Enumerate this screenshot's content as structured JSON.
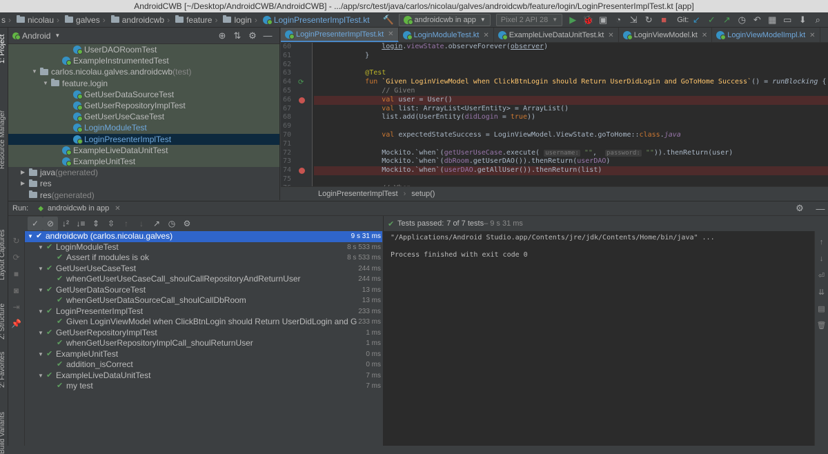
{
  "window_title": "AndroidCWB [~/Desktop/AndroidCWB/AndroidCWB] - .../app/src/test/java/carlos/nicolau/galves/androidcwb/feature/login/LoginPresenterImplTest.kt [app]",
  "nav": {
    "crumbs": [
      "s",
      "nicolau",
      "galves",
      "androidcwb",
      "feature",
      "login",
      "LoginPresenterImplTest.kt"
    ],
    "run_config": "androidcwb in app",
    "device": "Pixel 2 API 28",
    "git_label": "Git:"
  },
  "left_strip": {
    "project": "1: Project",
    "resource_manager": "Resource Manager",
    "layout_captures": "Layout Captures",
    "structure": "Z: Structure",
    "favorites": "2: Favorites",
    "build_variants": "Build Variants"
  },
  "project": {
    "view": "Android",
    "tree": [
      {
        "label": "UserDAORoomTest",
        "indent": 5,
        "icon": "class",
        "style": "green"
      },
      {
        "label": "ExampleInstrumentedTest",
        "indent": 4,
        "icon": "class",
        "style": "green"
      },
      {
        "label": "carlos.nicolau.galves.androidcwb",
        "suffix": " (test)",
        "indent": 2,
        "icon": "folder",
        "expanded": true,
        "style": "green"
      },
      {
        "label": "feature.login",
        "indent": 3,
        "icon": "folder",
        "expanded": true,
        "style": "green"
      },
      {
        "label": "GetUserDataSourceTest",
        "indent": 5,
        "icon": "class",
        "style": "green"
      },
      {
        "label": "GetUserRepositoryImplTest",
        "indent": 5,
        "icon": "class",
        "style": "green"
      },
      {
        "label": "GetUserUseCaseTest",
        "indent": 5,
        "icon": "class",
        "style": "green"
      },
      {
        "label": "LoginModuleTest",
        "indent": 5,
        "icon": "class",
        "style": "green",
        "link": true
      },
      {
        "label": "LoginPresenterImplTest",
        "indent": 5,
        "icon": "class",
        "style": "sel",
        "link": true
      },
      {
        "label": "ExampleLiveDataUnitTest",
        "indent": 4,
        "icon": "class",
        "style": "green"
      },
      {
        "label": "ExampleUnitTest",
        "indent": 4,
        "icon": "class",
        "style": "green"
      },
      {
        "label": "java",
        "suffix": " (generated)",
        "indent": 1,
        "icon": "folder",
        "expanded": false,
        "style": ""
      },
      {
        "label": "res",
        "indent": 1,
        "icon": "folder",
        "expanded": false,
        "style": ""
      },
      {
        "label": "res",
        "suffix": " (generated)",
        "indent": 1,
        "icon": "folder",
        "style": ""
      }
    ]
  },
  "editor": {
    "tabs": [
      {
        "label": "LoginPresenterImplTest.kt",
        "active": true
      },
      {
        "label": "LoginModuleTest.kt",
        "active": false
      },
      {
        "label": "ExampleLiveDataUnitTest.kt",
        "active": false
      },
      {
        "label": "LoginViewModel.kt",
        "active": false
      },
      {
        "label": "LoginViewModelImpl.kt",
        "active": false
      }
    ],
    "line_numbers": [
      "60",
      "61",
      "62",
      "63",
      "64",
      "65",
      "66",
      "67",
      "68",
      "69",
      "70",
      "71",
      "72",
      "73",
      "74",
      "75",
      "76"
    ],
    "lines": [
      {
        "html": "            <span class=\"und\">login</span>.<span class=\"prop\">viewState</span>.observeForever(<span class=\"und\">observer</span>)"
      },
      {
        "html": "        }"
      },
      {
        "html": ""
      },
      {
        "html": "        <span class=\"ann\">@Test</span>"
      },
      {
        "html": "        <span class=\"kw\">fun</span> <span class=\"fn\">`Given LoginViewModel when ClickBtnLogin should Return UserDidLogin and GoToHome Success`</span>() = <span class=\"it\">runBlocking</span> { <span class=\"hint\">this: Corout</span>",
        "marker": "run"
      },
      {
        "html": "            <span class=\"cm\">// Given</span>"
      },
      {
        "html": "            <span class=\"kw\">val</span> user = User()",
        "marker": "bp",
        "err": true
      },
      {
        "html": "            <span class=\"kw\">val</span> list: ArrayList&lt;UserEntity&gt; = ArrayList()"
      },
      {
        "html": "            list.add(UserEntity(<span class=\"prop\">didLogin</span> = <span class=\"kw\">true</span>))"
      },
      {
        "html": ""
      },
      {
        "html": "            <span class=\"kw\">val</span> expectedStateSuccess = LoginViewModel.ViewState.goToHome::<span class=\"kw\">class</span>.<span class=\"prop it\">java</span>"
      },
      {
        "html": ""
      },
      {
        "html": "            Mockito.`when`(<span class=\"prop\">getUserUseCase</span>.execute( <span class=\"hint\">username:</span> <span class=\"str\">\"\"</span>,  <span class=\"hint\">password:</span> <span class=\"str\">\"\"</span>)).thenReturn(user)"
      },
      {
        "html": "            Mockito.`when`(<span class=\"prop\">dbRoom</span>.getUserDAO()).thenReturn(<span class=\"prop\">userDAO</span>)"
      },
      {
        "html": "            Mockito.`when`(<span class=\"prop\">userDAO</span>.getAllUser()).thenReturn(list)",
        "marker": "bp",
        "err": true
      },
      {
        "html": ""
      },
      {
        "html": "            <span class=\"cm\">// When</span>"
      }
    ],
    "breadcrumb": [
      "LoginPresenterImplTest",
      "setup()"
    ]
  },
  "run": {
    "label": "Run:",
    "tab": "androidcwb in app",
    "status": "Tests passed:",
    "status_counts": "7 of 7 tests",
    "status_time": " – 9 s 31 ms",
    "results": [
      {
        "label": "androidcwb (carlos.nicolau.galves)",
        "time": "9 s 31 ms",
        "indent": 0,
        "sel": true,
        "expand": true
      },
      {
        "label": "LoginModuleTest",
        "time": "8 s 533 ms",
        "indent": 1,
        "expand": true
      },
      {
        "label": "Assert if modules is ok",
        "time": "8 s 533 ms",
        "indent": 2
      },
      {
        "label": "GetUserUseCaseTest",
        "time": "244 ms",
        "indent": 1,
        "expand": true
      },
      {
        "label": "whenGetUserUseCaseCall_shoulCallRepositoryAndReturnUser",
        "time": "244 ms",
        "indent": 2
      },
      {
        "label": "GetUserDataSourceTest",
        "time": "13 ms",
        "indent": 1,
        "expand": true
      },
      {
        "label": "whenGetUserDataSourceCall_shoulCallDbRoom",
        "time": "13 ms",
        "indent": 2
      },
      {
        "label": "LoginPresenterImplTest",
        "time": "233 ms",
        "indent": 1,
        "expand": true
      },
      {
        "label": "Given LoginViewModel when ClickBtnLogin should Return UserDidLogin and G",
        "time": "233 ms",
        "indent": 2
      },
      {
        "label": "GetUserRepositoryImplTest",
        "time": "1 ms",
        "indent": 1,
        "expand": true
      },
      {
        "label": "whenGetUserRepositoryImplCall_shoulReturnUser",
        "time": "1 ms",
        "indent": 2
      },
      {
        "label": "ExampleUnitTest",
        "time": "0 ms",
        "indent": 1,
        "expand": true
      },
      {
        "label": "addition_isCorrect",
        "time": "0 ms",
        "indent": 2
      },
      {
        "label": "ExampleLiveDataUnitTest",
        "time": "7 ms",
        "indent": 1,
        "expand": true
      },
      {
        "label": "my test",
        "time": "7 ms",
        "indent": 2
      }
    ],
    "console_lines": [
      "\"/Applications/Android Studio.app/Contents/jre/jdk/Contents/Home/bin/java\" ...",
      "",
      "Process finished with exit code 0"
    ]
  },
  "colors": {
    "accent": "#4a88c7",
    "pass": "#5e9e5f",
    "selection": "#2f65ca",
    "breakpoint": "#c75450"
  }
}
